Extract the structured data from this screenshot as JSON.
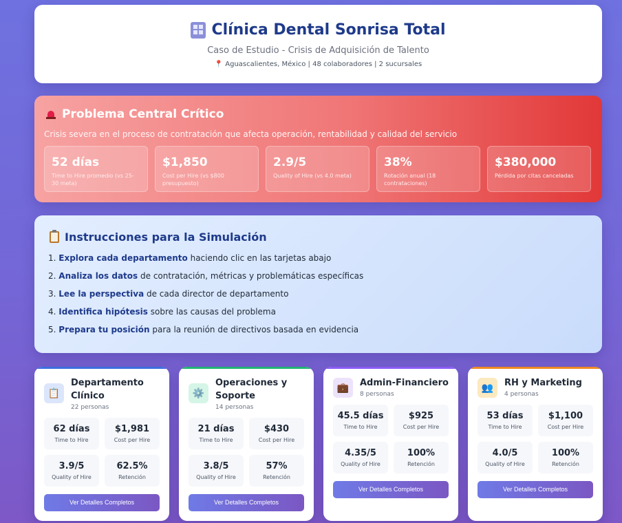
{
  "header": {
    "title": "Clínica Dental Sonrisa Total",
    "subtitle": "Caso de Estudio - Crisis de Adquisición de Talento",
    "meta": "Aguascalientes, México | 48 colaboradores | 2 sucursales"
  },
  "problem": {
    "title": "Problema Central Crítico",
    "description": "Crisis severa en el proceso de contratación que afecta operación, rentabilidad y calidad del servicio",
    "stats": [
      {
        "value": "52 días",
        "label": "Time to Hire promedio (vs 25-30 meta)"
      },
      {
        "value": "$1,850",
        "label": "Cost per Hire (vs $800 presupuesto)"
      },
      {
        "value": "2.9/5",
        "label": "Quality of Hire (vs 4.0 meta)"
      },
      {
        "value": "38%",
        "label": "Rotación anual (18 contrataciones)"
      },
      {
        "value": "$380,000",
        "label": "Pérdida por citas canceladas"
      }
    ]
  },
  "instructions": {
    "title": "Instrucciones para la Simulación",
    "items": [
      {
        "num": "1.",
        "bold": "Explora cada departamento",
        "rest": " haciendo clic en las tarjetas abajo"
      },
      {
        "num": "2.",
        "bold": "Analiza los datos",
        "rest": " de contratación, métricas y problemáticas específicas"
      },
      {
        "num": "3.",
        "bold": "Lee la perspectiva",
        "rest": " de cada director de departamento"
      },
      {
        "num": "4.",
        "bold": "Identifica hipótesis",
        "rest": " sobre las causas del problema"
      },
      {
        "num": "5.",
        "bold": "Prepara tu posición",
        "rest": " para la reunión de directivos basada en evidencia"
      }
    ]
  },
  "departments": [
    {
      "name": "Departamento Clínico",
      "count": "22 personas",
      "time": "62 días",
      "cost": "$1,981",
      "quality": "3.9/5",
      "retention": "62.5%",
      "button": "Ver Detalles Completos",
      "accent": "#3b6fe0",
      "icon": "clipboard-icon"
    },
    {
      "name": "Operaciones y Soporte",
      "count": "14 personas",
      "time": "21 días",
      "cost": "$430",
      "quality": "3.8/5",
      "retention": "57%",
      "button": "Ver Detalles Completos",
      "accent": "#22b573",
      "icon": "gear-icon"
    },
    {
      "name": "Admin-Financiero",
      "count": "8 personas",
      "time": "45.5 días",
      "cost": "$925",
      "quality": "4.35/5",
      "retention": "100%",
      "button": "Ver Detalles Completos",
      "accent": "#8b5cf6",
      "icon": "briefcase-icon"
    },
    {
      "name": "RH y Marketing",
      "count": "4 personas",
      "time": "53 días",
      "cost": "$1,100",
      "quality": "4.0/5",
      "retention": "100%",
      "button": "Ver Detalles Completos",
      "accent": "#f08a24",
      "icon": "people-icon"
    }
  ],
  "labels": {
    "time_to_hire": "Time to Hire",
    "cost_per_hire": "Cost per Hire",
    "quality_of_hire": "Quality of Hire",
    "retention": "Retención"
  }
}
